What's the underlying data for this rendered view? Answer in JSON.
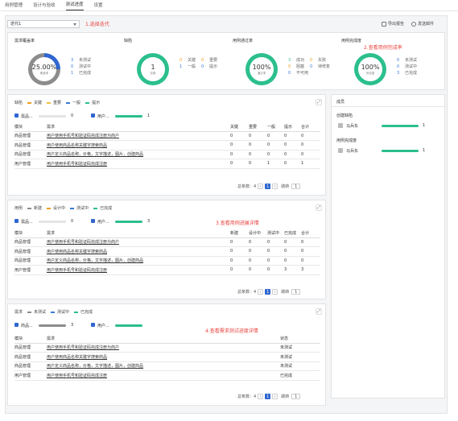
{
  "tabs": [
    "用例管理",
    "设计与验收",
    "测试进度",
    "设置"
  ],
  "active_tab": "测试进度",
  "iteration_select": "迭代1",
  "annotations": {
    "a1": "1.选择迭代",
    "a2": "2.查看用例完成率",
    "a3": "3.查看用例进展详情",
    "a4": "4.查看需求测试进度详情"
  },
  "toolbar": {
    "export": "导出报告",
    "send": "发送邮件"
  },
  "summary": {
    "coverage": {
      "title": "需求覆盖率",
      "value": "25.00%",
      "caption": "覆盖率",
      "stats": [
        {
          "n": "3",
          "label": "未测试"
        },
        {
          "n": "0",
          "label": "测试中"
        },
        {
          "n": "1",
          "label": "已完成"
        }
      ]
    },
    "defects": {
      "title": "缺陷",
      "value": "1",
      "caption": "总数",
      "stats_left": [
        {
          "n": "0",
          "label": "关键"
        },
        {
          "n": "1",
          "label": "一般"
        }
      ],
      "stats_right": [
        {
          "n": "0",
          "label": "重要"
        },
        {
          "n": "0",
          "label": "提示"
        }
      ]
    },
    "passrate": {
      "title": "用例通过率",
      "value": "100%",
      "caption": "通过率",
      "stats_left": [
        {
          "n": "3",
          "label": "成功"
        },
        {
          "n": "0",
          "label": "阻塞"
        },
        {
          "n": "0",
          "label": "不可用"
        }
      ],
      "stats_right": [
        {
          "n": "0",
          "label": "失败"
        },
        {
          "n": "0",
          "label": "待修复"
        }
      ]
    },
    "completion": {
      "title": "用例完成度",
      "value": "100%",
      "caption": "完成度",
      "stats": [
        {
          "n": "0",
          "label": "未测试"
        },
        {
          "n": "0",
          "label": "测试中"
        },
        {
          "n": "3",
          "label": "已完成"
        }
      ]
    }
  },
  "defect_panel": {
    "title": "缺陷",
    "legend": [
      "关键",
      "重要",
      "一般",
      "提示"
    ],
    "filter1": {
      "label": "需品...",
      "count": "0"
    },
    "filter2": {
      "label": "用户...",
      "count": "1"
    },
    "columns": [
      "模块",
      "需求",
      "关键",
      "重要",
      "一般",
      "提示",
      "合计"
    ],
    "rows": [
      [
        "商品管理",
        "用户使用手机号和验证码完成注册为商户",
        "0",
        "0",
        "0",
        "0",
        "0"
      ],
      [
        "商品管理",
        "用户使用商品名称关键字搜索商品",
        "0",
        "0",
        "0",
        "0",
        "0"
      ],
      [
        "商品管理",
        "用户定义商品名称，价格，文字描述，图片，创建商品",
        "0",
        "0",
        "0",
        "0",
        "0"
      ],
      [
        "用户管理",
        "用户使用手机号和验证码完成注册",
        "0",
        "0",
        "1",
        "0",
        "1"
      ]
    ],
    "total_label": "总条数：4",
    "page": "1",
    "jump_label": "跳转",
    "jump_val": "1"
  },
  "case_panel": {
    "title": "用例",
    "legend": [
      "新建",
      "设计中",
      "测试中",
      "已完成"
    ],
    "filter1": {
      "label": "需品...",
      "count": "0"
    },
    "filter2": {
      "label": "用户...",
      "count": "3"
    },
    "columns": [
      "模块",
      "需求",
      "新建",
      "设计中",
      "测试中",
      "已完成",
      "合计"
    ],
    "rows": [
      [
        "商品管理",
        "用户使用手机号和验证码完成注册为商户",
        "0",
        "0",
        "0",
        "0",
        "0"
      ],
      [
        "商品管理",
        "用户使用商品名称关键字搜索商品",
        "0",
        "0",
        "0",
        "0",
        "0"
      ],
      [
        "商品管理",
        "用户定义商品名称，价格，文字描述，图片，创建商品",
        "0",
        "0",
        "0",
        "0",
        "0"
      ],
      [
        "用户管理",
        "用户使用手机号和验证码完成注册",
        "0",
        "0",
        "0",
        "3",
        "3"
      ]
    ],
    "total_label": "总条数：4",
    "page": "1",
    "jump_label": "跳转",
    "jump_val": "1"
  },
  "req_panel": {
    "title": "需求",
    "legend": [
      "未测试",
      "测试中",
      "已完成"
    ],
    "filter1": {
      "label": "商品...",
      "count": "3"
    },
    "filter2": {
      "label": "用户...",
      "count": ""
    },
    "columns": [
      "模块",
      "需求",
      "状态"
    ],
    "rows": [
      [
        "商品管理",
        "用户使用手机号和验证码完成注册为商户",
        "未测试"
      ],
      [
        "商品管理",
        "用户使用商品名称关键字搜索商品",
        "未测试"
      ],
      [
        "商品管理",
        "用户定义商品名称，价格，文字描述，图片，创建商品",
        "未测试"
      ],
      [
        "用户管理",
        "用户使用手机号和验证码完成注册",
        "已完成"
      ]
    ],
    "total_label": "总条数：4",
    "page": "1",
    "jump_label": "跳转",
    "jump_val": "1"
  },
  "members": {
    "title": "成员",
    "group1": "创建缺陷",
    "group1_name": "马兵东",
    "group1_count": "1",
    "group2": "用例完成度",
    "group2_name": "马兵东",
    "group2_count": "1"
  },
  "colors": {
    "blue": "#3a7bd5",
    "orange": "#f0a020",
    "green": "#2bbf8c",
    "gray": "#8c8c8c",
    "red": "#e8413b"
  }
}
